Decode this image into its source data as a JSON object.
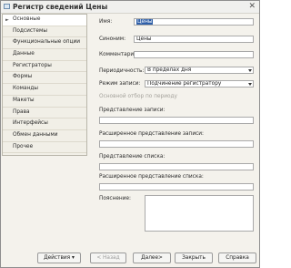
{
  "window": {
    "title": "Регистр сведений Цены"
  },
  "sidebar": {
    "items": [
      {
        "label": "Основные"
      },
      {
        "label": "Подсистемы"
      },
      {
        "label": "Функциональные опции"
      },
      {
        "label": "Данные"
      },
      {
        "label": "Регистраторы"
      },
      {
        "label": "Формы"
      },
      {
        "label": "Команды"
      },
      {
        "label": "Макеты"
      },
      {
        "label": "Права"
      },
      {
        "label": "Интерфейсы"
      },
      {
        "label": "Обмен данными"
      },
      {
        "label": "Прочее"
      }
    ]
  },
  "form": {
    "name_label": "Имя:",
    "name_value": "Цены",
    "synonym_label": "Синоним:",
    "synonym_value": "Цены",
    "comment_label": "Комментарий:",
    "comment_value": "",
    "periodicity_label": "Периодичность:",
    "periodicity_value": "В пределах дня",
    "write_mode_label": "Режим записи:",
    "write_mode_value": "Подчинение регистратору",
    "main_filter_label": "Основной отбор по периоду",
    "record_repr_label": "Представление записи:",
    "record_repr_value": "",
    "ext_record_repr_label": "Расширенное представление записи:",
    "ext_record_repr_value": "",
    "list_repr_label": "Представление списка:",
    "list_repr_value": "",
    "ext_list_repr_label": "Расширенное представление списка:",
    "ext_list_repr_value": "",
    "explanation_label": "Пояснение:"
  },
  "buttons": {
    "actions": "Действия",
    "back": "< Назад",
    "next": "Далее>",
    "close": "Закрыть",
    "help": "Справка"
  }
}
